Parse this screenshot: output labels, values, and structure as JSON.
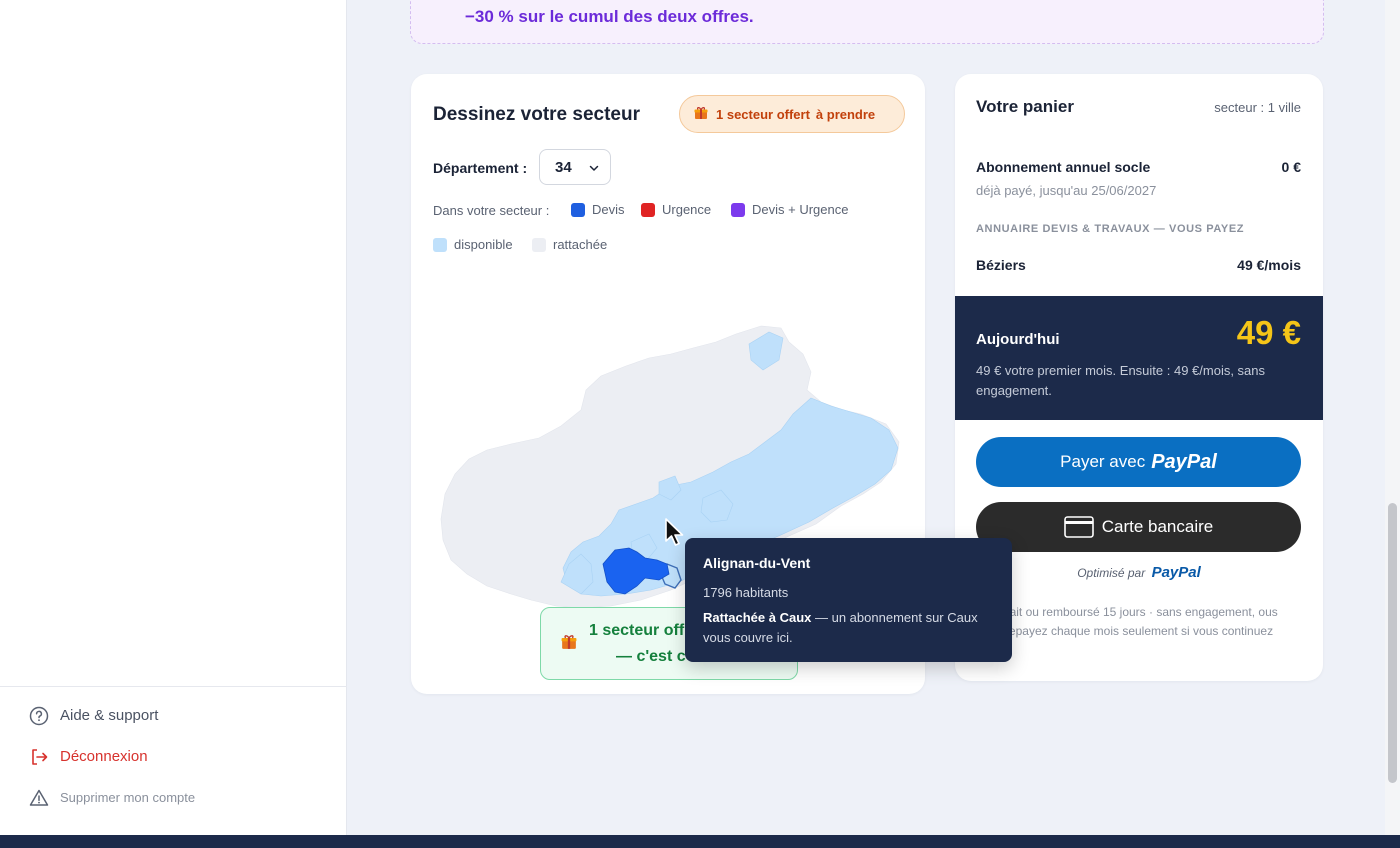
{
  "promo": {
    "text": "−30 % sur le cumul des deux offres."
  },
  "sidebar": {
    "links": [
      {
        "label": "Aide & support",
        "icon": "help-circle-icon"
      },
      {
        "label": "Déconnexion",
        "icon": "logout-icon"
      },
      {
        "label": "Supprimer mon compte",
        "icon": "warning-triangle-icon"
      }
    ]
  },
  "sector": {
    "title": "Dessinez votre secteur",
    "gift_badge": {
      "text": "1 secteur offert",
      "action": "à prendre"
    },
    "department_label": "Département :",
    "department_value": "34",
    "legend_caption": "Dans votre secteur :",
    "legend": [
      {
        "label": "Devis",
        "color": "#1f5fe0"
      },
      {
        "label": "Urgence",
        "color": "#e02424"
      },
      {
        "label": "Devis + Urgence",
        "color": "#7c3aed"
      },
      {
        "label": "disponible",
        "color": "#bfe0fb"
      },
      {
        "label": "rattachée",
        "color": "#eceef3"
      }
    ],
    "offer_pill": {
      "line1": "1 secteur off",
      "line2": "— c'est c"
    }
  },
  "tooltip": {
    "name": "Alignan-du-Vent",
    "population": "1796 habitants",
    "attached_bold": "Rattachée à Caux",
    "attached_rest": " — un abonnement sur Caux vous couvre ici."
  },
  "cart": {
    "title": "Votre panier",
    "meta": "secteur : 1 ville",
    "base_label": "Abonnement annuel socle",
    "base_value": "0 €",
    "base_sub": "déjà payé, jusqu'au 25/06/2027",
    "section_caption": "ANNUAIRE DEVIS & TRAVAUX — VOUS PAYEZ",
    "city_label": "Béziers",
    "city_value": "49 €/mois",
    "today_label": "Aujourd'hui",
    "today_amount": "49 €",
    "today_desc": "49 € votre premier mois. Ensuite : 49 €/mois, sans engagement.",
    "paypal_prefix": "Payer avec",
    "paypal_brand": "PayPal",
    "card_label": "Carte bancaire",
    "optimized_prefix": "Optimisé par",
    "optimized_brand": "PayPal",
    "guarantee": "sfait ou remboursé 15 jours · sans engagement, ous repayez chaque mois seulement si vous continuez"
  },
  "colors": {
    "accent_purple": "#6c2bd9",
    "navy": "#1c2a4a",
    "paypal_blue": "#0a6fc2",
    "price_yellow": "#f5c518",
    "map_available": "#bfe0fb",
    "map_attached": "#eceef3",
    "map_devis": "#1f5fe0"
  }
}
